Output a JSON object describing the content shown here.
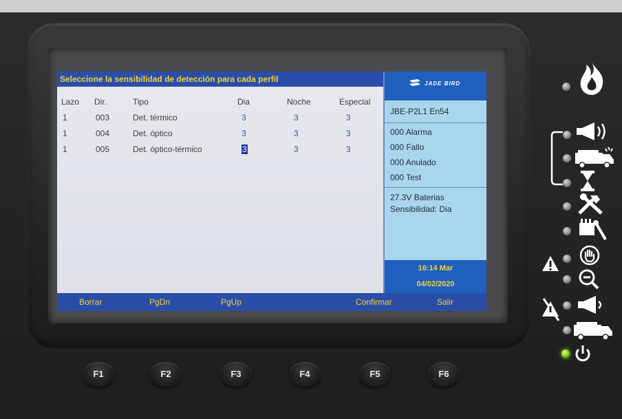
{
  "screen": {
    "title": "Seleccione la sensibilidad de detección para cada perfil",
    "columns": [
      "Lazo",
      "Dir.",
      "Tipo",
      "Dia",
      "Noche",
      "Especial"
    ],
    "rows": [
      {
        "lazo": "1",
        "dir": "003",
        "tipo": "Det. térmico",
        "dia": "3",
        "noche": "3",
        "especial": "3"
      },
      {
        "lazo": "1",
        "dir": "004",
        "tipo": "Det. óptico",
        "dia": "3",
        "noche": "3",
        "especial": "3"
      },
      {
        "lazo": "1",
        "dir": "005",
        "tipo": "Det. óptico-térmico",
        "dia": "3",
        "noche": "3",
        "especial": "3"
      }
    ]
  },
  "status_panel": {
    "logo": "JADE BIRD",
    "model": "JBE-P2L1 En54",
    "alarma": "000 Alarma",
    "fallo": "000 Fallo",
    "anulado": "000 Anulado",
    "test": "000 Test",
    "baterias": "27.3V Baterias",
    "sensibilidad": "Sensibilidad:  Dia",
    "time": "16:14 Mar",
    "date": "04/02/2020"
  },
  "function_bar": {
    "f1": "Borrar",
    "f2": "PgDn",
    "f3": "PgUp",
    "f4": "",
    "f5": "Confirmar",
    "f6": "Salir"
  },
  "keys": [
    "F1",
    "F2",
    "F3",
    "F4",
    "F5",
    "F6"
  ],
  "indicators": [
    "fire-icon",
    "sounder-icon",
    "fire-brigade-icon",
    "delay-icon",
    "fault-icon",
    "supply-fault-icon",
    "disabled-icon",
    "test-icon",
    "sounder-fault-icon",
    "brigade-fault-icon",
    "power-icon"
  ],
  "colors": {
    "screen_bar": "#2a4ea8",
    "bar_text": "#f0d23a",
    "status_panel": "#a9d6ec",
    "power_led": "#7cc81a"
  }
}
